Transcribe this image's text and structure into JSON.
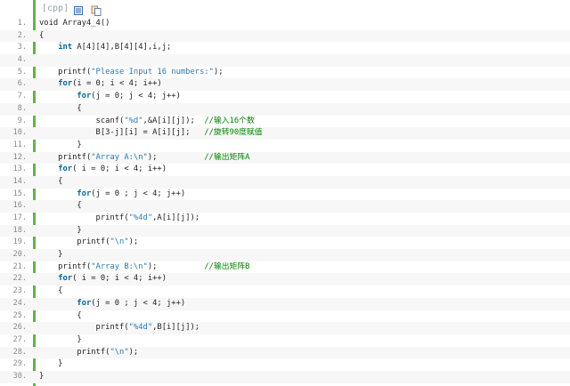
{
  "toolbar": {
    "lang_tag": "[cpp]",
    "icons": [
      "view-source-icon",
      "copy-icon"
    ]
  },
  "colors": {
    "gutter_accent": "#6ab04c",
    "keyword": "#006699",
    "string": "#2a7ab0",
    "comment": "#008200",
    "line_number": "#8a8a8a"
  },
  "code_lines": [
    {
      "n": "1.",
      "parts": [
        [
          "t",
          "void Array4_4()"
        ]
      ]
    },
    {
      "n": "2.",
      "parts": [
        [
          "t",
          "{"
        ]
      ]
    },
    {
      "n": "3.",
      "parts": [
        [
          "t",
          "    "
        ],
        [
          "kw",
          "int"
        ],
        [
          "t",
          " A[4][4],B[4][4],i,j;"
        ]
      ]
    },
    {
      "n": "4.",
      "parts": [
        [
          "t",
          ""
        ]
      ]
    },
    {
      "n": "5.",
      "parts": [
        [
          "t",
          "    printf("
        ],
        [
          "str",
          "\"Please Input 16 numbers:\""
        ],
        [
          "t",
          ");"
        ]
      ]
    },
    {
      "n": "6.",
      "parts": [
        [
          "t",
          "    "
        ],
        [
          "kw",
          "for"
        ],
        [
          "t",
          "(i = 0; i < 4; i++)"
        ]
      ]
    },
    {
      "n": "7.",
      "parts": [
        [
          "t",
          "        "
        ],
        [
          "kw",
          "for"
        ],
        [
          "t",
          "(j = 0; j < 4; j++)"
        ]
      ]
    },
    {
      "n": "8.",
      "parts": [
        [
          "t",
          "        {"
        ]
      ]
    },
    {
      "n": "9.",
      "parts": [
        [
          "t",
          "            scanf("
        ],
        [
          "str",
          "\"%d\""
        ],
        [
          "t",
          ",&A[i][j]);  "
        ],
        [
          "cm",
          "//输入16个数"
        ]
      ]
    },
    {
      "n": "10.",
      "parts": [
        [
          "t",
          "            B[3-j][i] = A[i][j];   "
        ],
        [
          "cm",
          "//旋转90度赋值"
        ]
      ]
    },
    {
      "n": "11.",
      "parts": [
        [
          "t",
          "        }"
        ]
      ]
    },
    {
      "n": "12.",
      "parts": [
        [
          "t",
          "    printf("
        ],
        [
          "str",
          "\"Array A:\\n\""
        ],
        [
          "t",
          ");          "
        ],
        [
          "cm",
          "//输出矩阵A"
        ]
      ]
    },
    {
      "n": "13.",
      "parts": [
        [
          "t",
          "    "
        ],
        [
          "kw",
          "for"
        ],
        [
          "t",
          "( i = 0; i < 4; i++)"
        ]
      ]
    },
    {
      "n": "14.",
      "parts": [
        [
          "t",
          "    {"
        ]
      ]
    },
    {
      "n": "15.",
      "parts": [
        [
          "t",
          "        "
        ],
        [
          "kw",
          "for"
        ],
        [
          "t",
          "(j = 0 ; j < 4; j++)"
        ]
      ]
    },
    {
      "n": "16.",
      "parts": [
        [
          "t",
          "        {"
        ]
      ]
    },
    {
      "n": "17.",
      "parts": [
        [
          "t",
          "            printf("
        ],
        [
          "str",
          "\"%4d\""
        ],
        [
          "t",
          ",A[i][j]);"
        ]
      ]
    },
    {
      "n": "18.",
      "parts": [
        [
          "t",
          "        }"
        ]
      ]
    },
    {
      "n": "19.",
      "parts": [
        [
          "t",
          "        printf("
        ],
        [
          "str",
          "\"\\n\""
        ],
        [
          "t",
          ");"
        ]
      ]
    },
    {
      "n": "20.",
      "parts": [
        [
          "t",
          "    }"
        ]
      ]
    },
    {
      "n": "21.",
      "parts": [
        [
          "t",
          "    printf("
        ],
        [
          "str",
          "\"Array B:\\n\""
        ],
        [
          "t",
          ");          "
        ],
        [
          "cm",
          "//输出矩阵B"
        ]
      ]
    },
    {
      "n": "22.",
      "parts": [
        [
          "t",
          "    "
        ],
        [
          "kw",
          "for"
        ],
        [
          "t",
          "( i = 0; i < 4; i++)"
        ]
      ]
    },
    {
      "n": "23.",
      "parts": [
        [
          "t",
          "    {"
        ]
      ]
    },
    {
      "n": "24.",
      "parts": [
        [
          "t",
          "        "
        ],
        [
          "kw",
          "for"
        ],
        [
          "t",
          "(j = 0 ; j < 4; j++)"
        ]
      ]
    },
    {
      "n": "25.",
      "parts": [
        [
          "t",
          "        {"
        ]
      ]
    },
    {
      "n": "26.",
      "parts": [
        [
          "t",
          "            printf("
        ],
        [
          "str",
          "\"%4d\""
        ],
        [
          "t",
          ",B[i][j]);"
        ]
      ]
    },
    {
      "n": "27.",
      "parts": [
        [
          "t",
          "        }"
        ]
      ]
    },
    {
      "n": "28.",
      "parts": [
        [
          "t",
          "        printf("
        ],
        [
          "str",
          "\"\\n\""
        ],
        [
          "t",
          ");"
        ]
      ]
    },
    {
      "n": "29.",
      "parts": [
        [
          "t",
          "    }"
        ]
      ]
    },
    {
      "n": "30.",
      "parts": [
        [
          "t",
          "}"
        ]
      ]
    }
  ]
}
